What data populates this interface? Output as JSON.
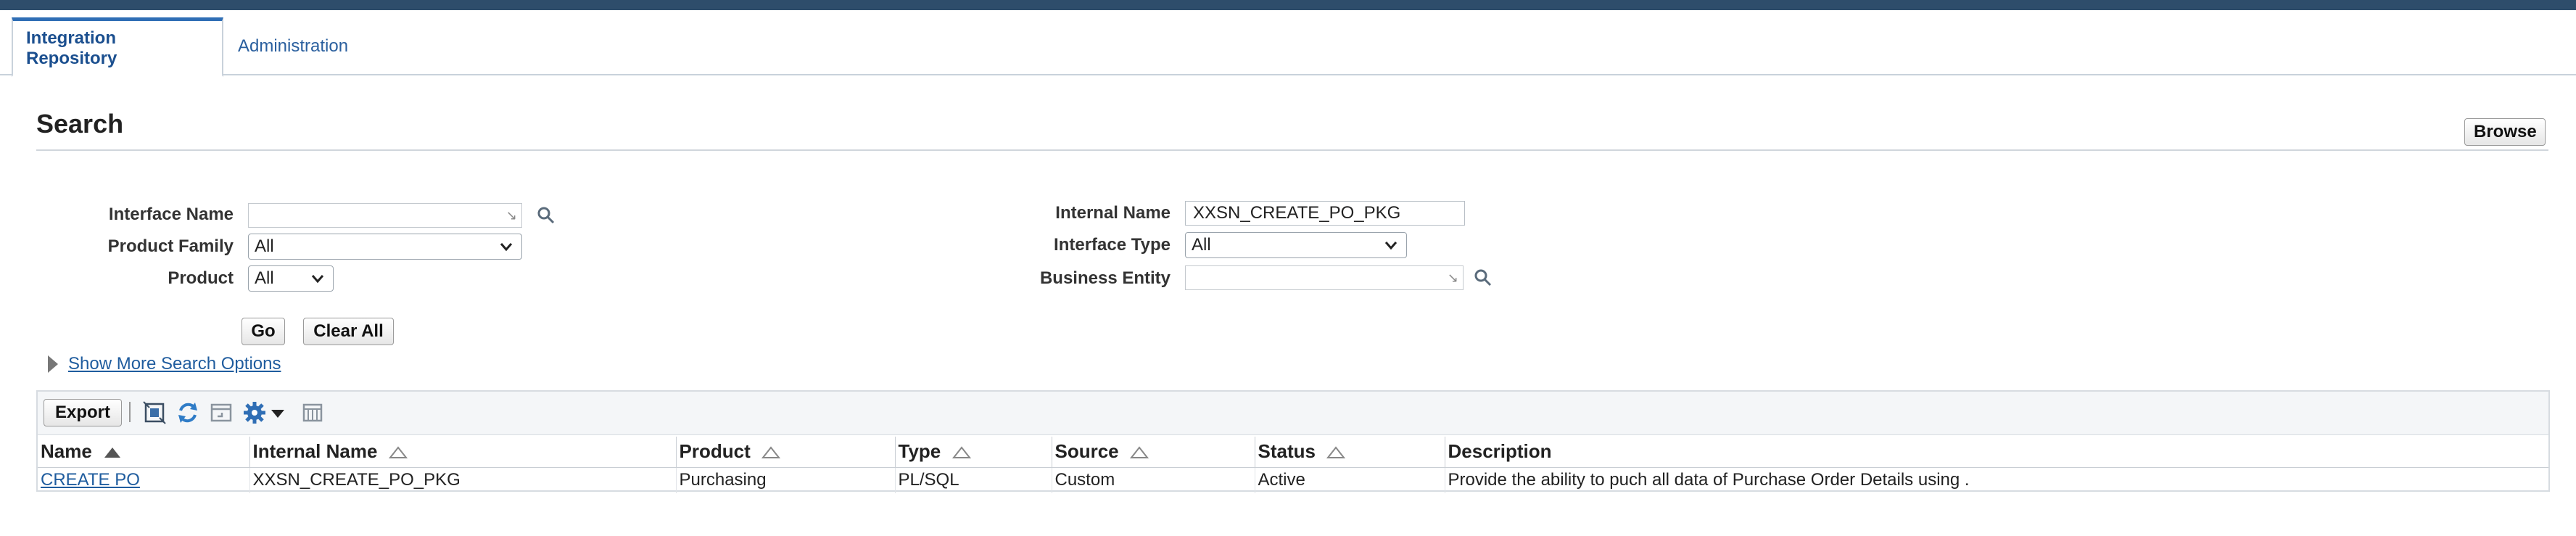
{
  "tabs": [
    {
      "label": "Integration Repository",
      "active": true
    },
    {
      "label": "Administration",
      "active": false
    }
  ],
  "search": {
    "title": "Search",
    "browse_label": "Browse",
    "fields": {
      "interface_name": {
        "label": "Interface Name",
        "value": "",
        "placeholder": ""
      },
      "product_family": {
        "label": "Product Family",
        "value": "All"
      },
      "product": {
        "label": "Product",
        "value": "All"
      },
      "internal_name": {
        "label": "Internal Name",
        "value": "XXSN_CREATE_PO_PKG"
      },
      "interface_type": {
        "label": "Interface Type",
        "value": "All"
      },
      "business_entity": {
        "label": "Business Entity",
        "value": ""
      }
    },
    "go_label": "Go",
    "clear_label": "Clear All",
    "more_options_label": "Show More Search Options"
  },
  "results": {
    "export_label": "Export",
    "columns": [
      "Name",
      "Internal Name",
      "Product",
      "Type",
      "Source",
      "Status",
      "Description"
    ],
    "rows": [
      {
        "name": "CREATE PO",
        "internal_name": "XXSN_CREATE_PO_PKG",
        "product": "Purchasing",
        "type": "PL/SQL",
        "source": "Custom",
        "status": "Active",
        "description": "Provide the ability to puch all data of Purchase Order Details using ."
      }
    ]
  },
  "colors": {
    "topbar": "#2e4d6b",
    "accent": "#2f6eb5",
    "link": "#1f5c9e"
  },
  "icons": [
    "search-icon",
    "chevron-down-icon",
    "detach-icon",
    "refresh-icon",
    "freeze-icon",
    "gear-icon",
    "columns-icon",
    "sort-ascending-icon",
    "sort-neutral-icon",
    "disclosure-icon"
  ]
}
